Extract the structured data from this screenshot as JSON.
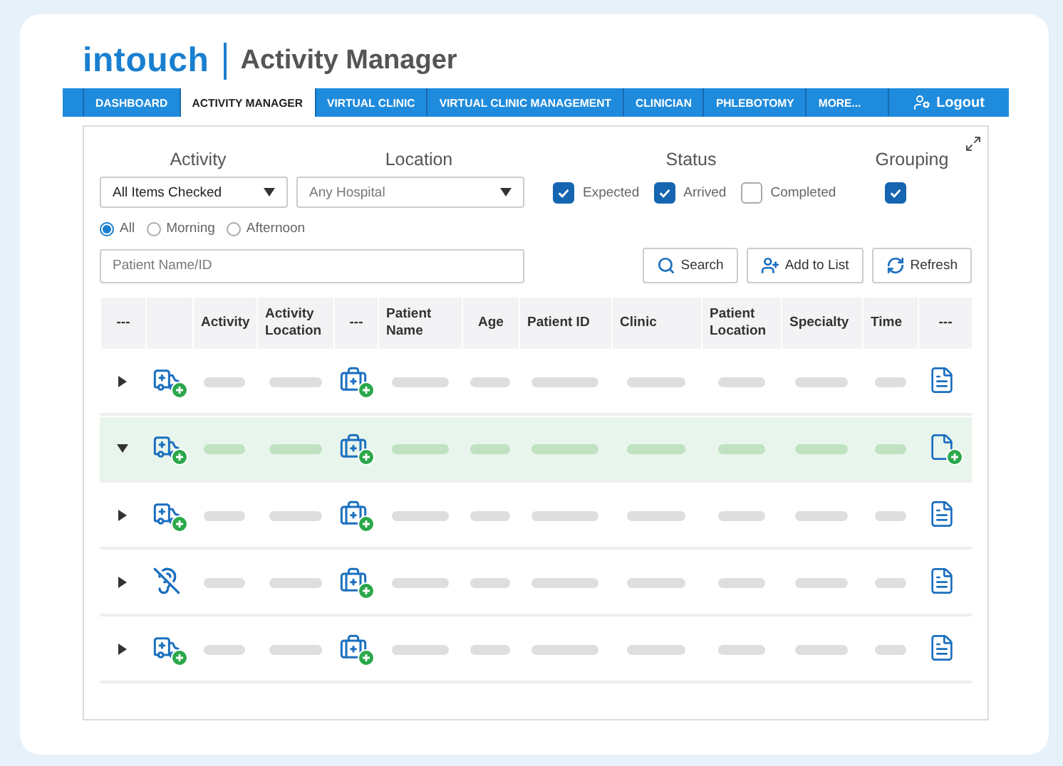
{
  "header": {
    "logo": "intouch",
    "title": "Activity Manager"
  },
  "nav": {
    "tabs": [
      {
        "label": "DASHBOARD",
        "selected": false
      },
      {
        "label": "ACTIVITY MANAGER",
        "selected": true
      },
      {
        "label": "VIRTUAL CLINIC",
        "selected": false
      },
      {
        "label": "VIRTUAL CLINIC MANAGEMENT",
        "selected": false
      },
      {
        "label": "CLINICIAN",
        "selected": false
      },
      {
        "label": "PHLEBOTOMY",
        "selected": false
      },
      {
        "label": "MORE...",
        "selected": false
      }
    ],
    "logout": "Logout"
  },
  "filters": {
    "activity": {
      "label": "Activity",
      "value": "All Items Checked"
    },
    "location": {
      "label": "Location",
      "value": "Any Hospital"
    },
    "status": {
      "label": "Status",
      "options": [
        {
          "label": "Expected",
          "checked": true
        },
        {
          "label": "Arrived",
          "checked": true
        },
        {
          "label": "Completed",
          "checked": false
        }
      ]
    },
    "grouping": {
      "label": "Grouping",
      "checked": true
    },
    "time_of_day": [
      {
        "label": "All",
        "selected": true
      },
      {
        "label": "Morning",
        "selected": false
      },
      {
        "label": "Afternoon",
        "selected": false
      }
    ],
    "search": {
      "placeholder": "Patient Name/ID"
    },
    "buttons": [
      {
        "kind": "search",
        "label": "Search"
      },
      {
        "kind": "add",
        "label": "Add to List"
      },
      {
        "kind": "refresh",
        "label": "Refresh"
      }
    ]
  },
  "table": {
    "columns": [
      "---",
      "",
      "Activity",
      "Activity Location",
      "---",
      "Patient Name",
      "Age",
      "Patient ID",
      "Clinic",
      "Patient Location",
      "Specialty",
      "Time",
      "---"
    ],
    "rows": [
      {
        "expanded": false,
        "activity_icon": {
          "kind": "ambulance"
        },
        "document_icon": {
          "kind": "document"
        }
      },
      {
        "expanded": true,
        "activity_icon": {
          "kind": "ambulance"
        },
        "document_icon": {
          "kind": "document-add"
        }
      },
      {
        "expanded": false,
        "activity_icon": {
          "kind": "ambulance"
        },
        "document_icon": {
          "kind": "document"
        }
      },
      {
        "expanded": false,
        "activity_icon": {
          "kind": "hearing"
        },
        "document_icon": {
          "kind": "document"
        }
      },
      {
        "expanded": false,
        "activity_icon": {
          "kind": "ambulance"
        },
        "document_icon": {
          "kind": "document"
        }
      }
    ]
  }
}
